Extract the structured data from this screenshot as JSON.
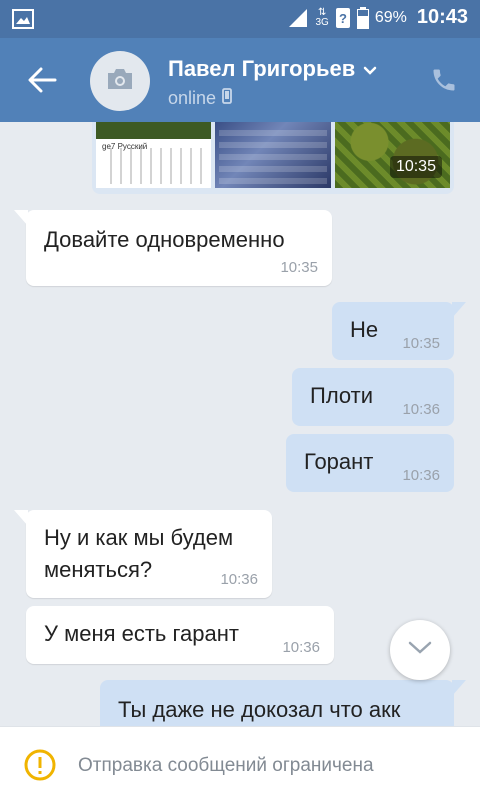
{
  "status_bar": {
    "signal_label": "3G",
    "battery": "69%",
    "time": "10:43"
  },
  "header": {
    "contact_name": "Павел Григорьев",
    "status": "online"
  },
  "photos": {
    "time": "10:35",
    "screenshot_note": "ge7 Русский"
  },
  "messages": [
    {
      "dir": "in",
      "text": "Довайте одновременно",
      "time": "10:35"
    },
    {
      "dir": "out",
      "text": "Не",
      "time": "10:35"
    },
    {
      "dir": "out",
      "text": "Плоти",
      "time": "10:36"
    },
    {
      "dir": "out",
      "text": "Горант",
      "time": "10:36"
    },
    {
      "dir": "in",
      "text_line1": "Ну и как мы будем",
      "text_line2": "меняться?",
      "time": "10:36"
    },
    {
      "dir": "in",
      "text": "У меня есть гарант",
      "time": "10:36"
    },
    {
      "dir": "out",
      "text": "Ты даже не докозал что акк",
      "time": ""
    }
  ],
  "bottom": {
    "notice": "Отправка сообщений ограничена"
  },
  "colors": {
    "status_bar": "#4a73a6",
    "header": "#5181b8",
    "chat_bg": "#e7ebf0",
    "outgoing": "#cfe0f4",
    "incoming": "#ffffff",
    "warning": "#f0b400"
  },
  "icons": [
    "gallery-icon",
    "data-arrows-icon",
    "sim-unknown-icon",
    "battery-icon",
    "back-arrow-icon",
    "camera-icon",
    "chevron-down-icon",
    "mobile-phone-icon",
    "phone-call-icon",
    "scroll-down-icon",
    "warning-icon"
  ]
}
